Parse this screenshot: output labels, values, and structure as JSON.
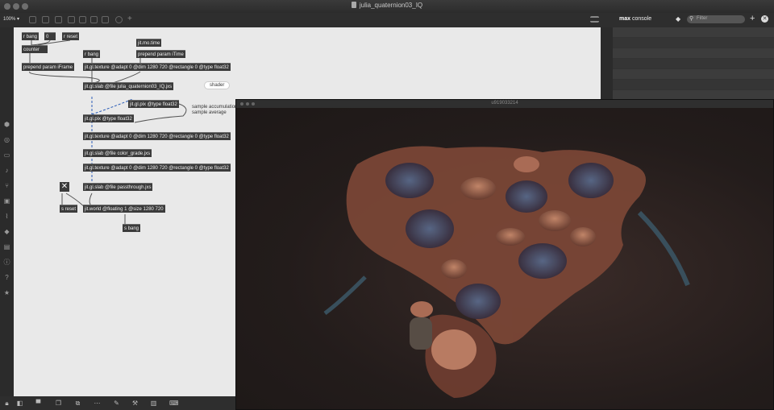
{
  "window": {
    "title": "julia_quaternion03_IQ"
  },
  "toolbar": {
    "zoom": "100% ▾"
  },
  "patcher": {
    "objects": {
      "r_bang": "r bang",
      "zero": "0",
      "r_reset": "r reset",
      "counter": "counter",
      "prepend_iframe": "prepend param iFrame",
      "jit_mo_time": "jit.mo.time",
      "r_bang2": "r bang",
      "prepend_itime": "prepend param iTime",
      "texture1": "jit.gl.texture @adapt 0 @dim 1280 720 @rectangle 0 @type float32",
      "slab_file": "jit.gl.slab @file julia_quaternion03_IQ.jxs",
      "pix1": "jit.gl.pix @type float32",
      "pix2": "jit.gl.pix @type float32",
      "texture2": "jit.gl.texture @adapt 0 @dim 1280 720 @rectangle 0 @type float32",
      "color_grade": "jit.gl.slab @file color_grade.jxs",
      "texture3": "jit.gl.texture @adapt 0 @dim 1280 720 @rectangle 0 @type float32",
      "passthrough": "jit.gl.slab @file passthrough.jxs",
      "s_reset": "s reset",
      "jit_world": "jit.world @floating 1 @size 1280 720",
      "s_bang": "s bang",
      "toggle": "✕"
    },
    "comments": {
      "shader": "shader",
      "sample_accum": "sample accumulation",
      "sample_avg": "sample average"
    }
  },
  "console": {
    "title_bold": "max",
    "title_rest": " console",
    "filter_placeholder": "Filter"
  },
  "render_window": {
    "title": "u919033214"
  },
  "colors": {
    "object_bg": "#3b3b3b",
    "patcher_bg": "#e9e9e9",
    "fractal": "#b07058"
  }
}
